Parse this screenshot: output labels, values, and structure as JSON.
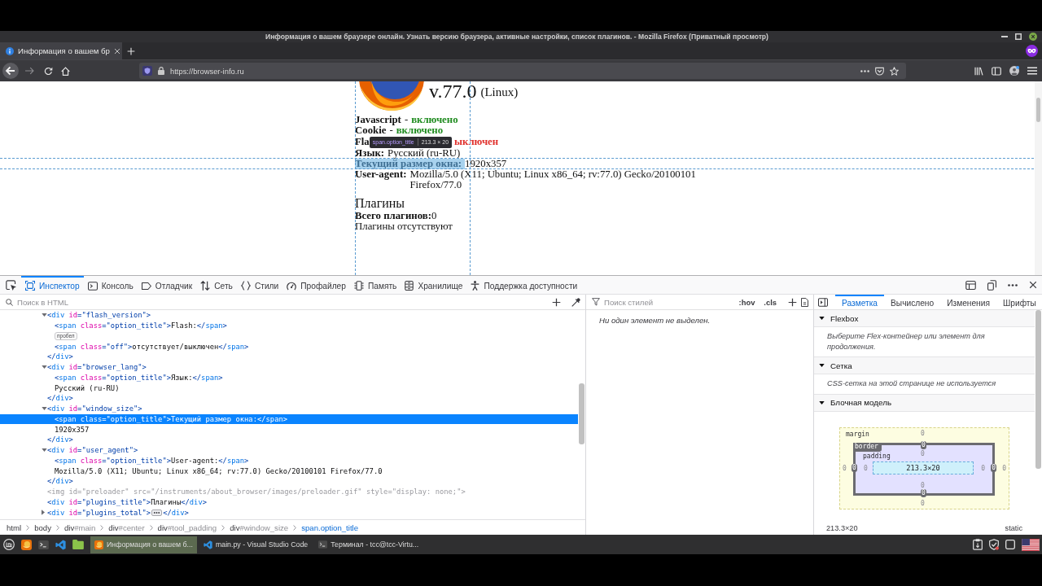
{
  "window": {
    "title": "Информация о вашем браузере онлайн. Узнать версию браузера, активные настройки, список плагинов. - Mozilla Firefox (Приватный просмотр)"
  },
  "tabs": [
    {
      "label": "Информация о вашем бр",
      "selected": true
    }
  ],
  "address_bar": {
    "url": "https://browser-info.ru"
  },
  "page": {
    "version": "v.77.0",
    "platform": "(Linux)",
    "options": [
      {
        "kind": "enabled",
        "label": "Javascript",
        "separator": "-",
        "value": "включено",
        "highlighted": false
      },
      {
        "kind": "enabled",
        "label": "Cookie",
        "separator": "-",
        "value": "включено",
        "highlighted": false
      },
      {
        "kind": "disabled",
        "label": "Fla",
        "value": "ыключен",
        "highlighted": false,
        "tooltip": {
          "selector": "span.option_title",
          "size": "213.3 × 20"
        }
      },
      {
        "kind": "plain",
        "label": "Язык:",
        "value": "Русский (ru-RU)",
        "highlighted": false
      },
      {
        "kind": "plain",
        "label": "Текущий размер окна:",
        "value": "1920x357",
        "highlighted": true
      },
      {
        "kind": "plain",
        "label": "User-agent:",
        "value": "Mozilla/5.0 (X11; Ubuntu; Linux x86_64; rv:77.0) Gecko/20100101 Firefox/77.0",
        "highlighted": false
      }
    ],
    "plugins": {
      "title": "Плагины",
      "total_label": "Всего плагинов:",
      "total": "0",
      "message": "Плагины отсутствуют"
    }
  },
  "devtools": {
    "tabs": [
      {
        "kind": "inspector",
        "label": "Инспектор",
        "selected": true
      },
      {
        "kind": "console",
        "label": "Консоль",
        "selected": false
      },
      {
        "kind": "debugger",
        "label": "Отладчик",
        "selected": false
      },
      {
        "kind": "network",
        "label": "Сеть",
        "selected": false
      },
      {
        "kind": "styles",
        "label": "Стили",
        "selected": false
      },
      {
        "kind": "profiler",
        "label": "Профайлер",
        "selected": false
      },
      {
        "kind": "memory",
        "label": "Память",
        "selected": false
      },
      {
        "kind": "storage",
        "label": "Хранилище",
        "selected": false
      },
      {
        "kind": "accessibility",
        "label": "Поддержка доступности",
        "selected": false
      }
    ],
    "markup_search": {
      "placeholder": "Поиск в HTML"
    },
    "markup": [
      {
        "kind": "element",
        "line": "<div id=\"flash_version\">",
        "selected": false,
        "expanded": true,
        "closing": "</div>",
        "children": [
          {
            "kind": "element",
            "line": "<span class=\"option_title\">Flash:</span>",
            "selected": false
          },
          {
            "kind": "whitespace",
            "line": "пробел",
            "selected": false
          },
          {
            "kind": "element",
            "line": "<span class=\"off\">отсутствует/выключен</span>",
            "selected": false
          }
        ]
      },
      {
        "kind": "element",
        "line": "<div id=\"browser_lang\">",
        "selected": false,
        "expanded": true,
        "closing": "</div>",
        "children": [
          {
            "kind": "element",
            "line": "<span class=\"option_title\">Язык:</span>",
            "selected": false
          },
          {
            "kind": "text",
            "line": "Русский (ru-RU)",
            "selected": false
          }
        ]
      },
      {
        "kind": "element",
        "line": "<div id=\"window_size\">",
        "selected": false,
        "expanded": true,
        "closing": "</div>",
        "children": [
          {
            "kind": "element",
            "line": "<span class=\"option_title\">Текущий размер окна:</span>",
            "selected": true
          },
          {
            "kind": "text",
            "line": "1920x357",
            "selected": false
          }
        ]
      },
      {
        "kind": "element",
        "line": "<div id=\"user_agent\">",
        "selected": false,
        "expanded": true,
        "closing": "</div>",
        "children": [
          {
            "kind": "element",
            "line": "<span class=\"option_title\">User-agent:</span>",
            "selected": false
          },
          {
            "kind": "text",
            "line": "Mozilla/5.0 (X11; Ubuntu; Linux x86_64; rv:77.0) Gecko/20100101 Firefox/77.0",
            "selected": false
          }
        ]
      },
      {
        "kind": "hidden",
        "line": "<img id=\"preloader\" src=\"/instruments/about_browser/images/preloader.gif\" style=\"display: none;\">",
        "selected": false
      },
      {
        "kind": "element",
        "line": "<div id=\"plugins_title\">Плагины</div>",
        "selected": false
      },
      {
        "kind": "element",
        "line": "<div id=\"plugins_total\">",
        "selected": false,
        "expanded": false,
        "closing": "</div>"
      }
    ],
    "breadcrumbs": [
      {
        "label": "html",
        "selected": false
      },
      {
        "label": "body",
        "selected": false
      },
      {
        "label": "div#main",
        "selected": false
      },
      {
        "label": "div#center",
        "selected": false
      },
      {
        "label": "div#tool_padding",
        "selected": false
      },
      {
        "label": "div#window_size",
        "selected": false
      },
      {
        "label": "span.option_title",
        "selected": true
      }
    ],
    "rules": {
      "placeholder": "Поиск стилей",
      "toggles": [
        ":hov",
        ".cls"
      ],
      "message": "Ни один элемент не выделен."
    },
    "sidebar": {
      "tabs": [
        {
          "label": "Разметка",
          "selected": true
        },
        {
          "label": "Вычислено",
          "selected": false
        },
        {
          "label": "Изменения",
          "selected": false
        },
        {
          "label": "Шрифты",
          "selected": false
        }
      ],
      "sections": [
        {
          "kind": "note",
          "title": "Flexbox",
          "expanded": true,
          "message": "Выберите Flex-контейнер или элемент для продолжения."
        },
        {
          "kind": "note",
          "title": "Сетка",
          "expanded": true,
          "message": "CSS-сетка на этой странице не используется"
        },
        {
          "kind": "box_model",
          "title": "Блочная модель",
          "expanded": true,
          "box_model": {
            "margin": {
              "label": "margin",
              "values": [
                "0",
                "0",
                "0",
                "0"
              ]
            },
            "border": {
              "label": "border",
              "values": [
                "0",
                "0",
                "0",
                "0"
              ]
            },
            "padding": {
              "label": "padding",
              "values": [
                "0",
                "0",
                "0",
                "0"
              ]
            },
            "content": "213.3×20"
          }
        }
      ],
      "element_size": "213.3×20",
      "position": "static"
    }
  },
  "taskbar": {
    "tasks": [
      {
        "kind": "browser",
        "label": "Информация о вашем б...",
        "selected": true
      },
      {
        "kind": "editor",
        "label": "main.py - Visual Studio Code",
        "selected": false
      },
      {
        "kind": "terminal",
        "label": "Терминал - tcc@tcc-Virtu...",
        "selected": false
      }
    ]
  }
}
